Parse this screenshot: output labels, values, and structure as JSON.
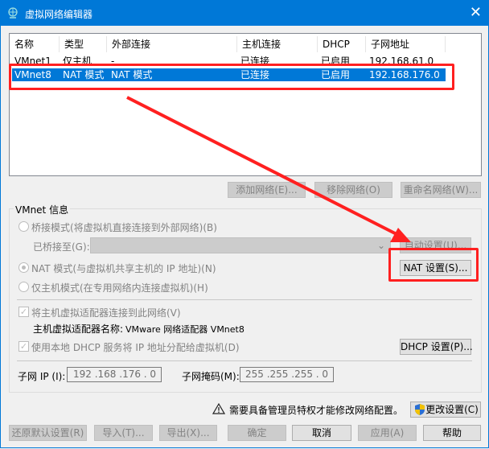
{
  "window": {
    "title": "虚拟网络编辑器",
    "close": "✕"
  },
  "table": {
    "columns": [
      "名称",
      "类型",
      "外部连接",
      "主机连接",
      "DHCP",
      "子网地址"
    ],
    "rows": [
      {
        "name": "VMnet1",
        "type": "仅主机",
        "external": "-",
        "host": "已连接",
        "dhcp": "已启用",
        "subnet": "192.168.61.0",
        "selected": false
      },
      {
        "name": "VMnet8",
        "type": "NAT 模式",
        "external": "NAT 模式",
        "host": "已连接",
        "dhcp": "已启用",
        "subnet": "192.168.176.0",
        "selected": true
      }
    ]
  },
  "list_buttons": {
    "add": "添加网络(E)...",
    "remove": "移除网络(O)",
    "rename": "重命名网络(W)..."
  },
  "vmnet_info": {
    "label": "VMnet 信息",
    "bridged": "桥接模式(将虚拟机直接连接到外部网络)(B)",
    "bridged_to": "已桥接至(G):",
    "auto_settings": "自动设置(U)...",
    "nat": "NAT 模式(与虚拟机共享主机的 IP 地址)(N)",
    "nat_settings": "NAT 设置(S)...",
    "host_only": "仅主机模式(在专用网络内连接虚拟机)(H)",
    "connect_adapter": "将主机虚拟适配器连接到此网络(V)",
    "adapter_name_label": "主机虚拟适配器名称:",
    "adapter_name": "VMware 网络适配器 VMnet8",
    "use_dhcp": "使用本地 DHCP 服务将 IP 地址分配给虚拟机(D)",
    "dhcp_settings": "DHCP 设置(P)...",
    "subnet_ip_label": "子网 IP (I):",
    "subnet_ip": "192 .168 .176 .  0",
    "subnet_mask_label": "子网掩码(M):",
    "subnet_mask": "255 .255 .255 .  0"
  },
  "admin": {
    "warning": "需要具备管理员特权才能修改网络配置。",
    "change": "更改设置(C)"
  },
  "footer": {
    "restore": "还原默认设置(R)",
    "import": "导入(T)...",
    "export": "导出(X)...",
    "ok": "确定",
    "cancel": "取消",
    "apply": "应用(A)",
    "help": "帮助"
  },
  "colors": {
    "accent": "#0078d7",
    "annotation": "#ff2020"
  }
}
